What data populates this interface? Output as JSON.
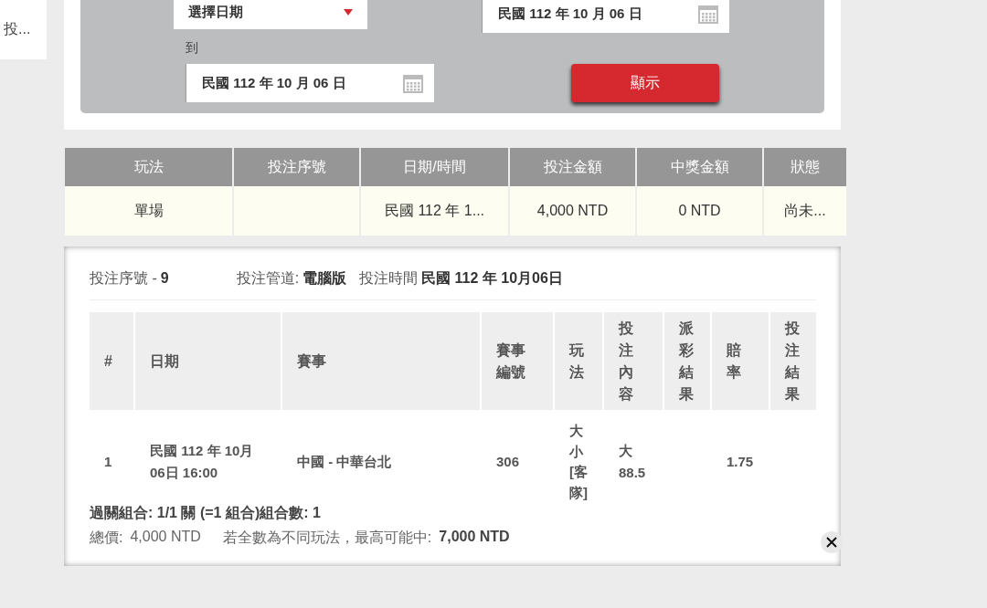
{
  "side_tab": {
    "label": "投..."
  },
  "filter": {
    "date_select": "選擇日期",
    "from_date": "民國 112 年 10 月 06 日",
    "to_label": "到",
    "to_date": "民國 112 年 10 月 06 日",
    "show_button": "顯示"
  },
  "summary_table": {
    "columns": [
      "玩法",
      "投注序號",
      "日期/時間",
      "投注金額",
      "中獎金額",
      "狀態"
    ],
    "rows": [
      [
        "單場",
        "",
        "民國 112 年 1...",
        "4,000 NTD",
        "0 NTD",
        "尚未..."
      ]
    ]
  },
  "detail": {
    "meta": [
      {
        "label": "投注序號 -",
        "value": "9"
      },
      {
        "label": "投注管道:",
        "value": "電腦版"
      },
      {
        "label": "投注時間",
        "value": "民國 112 年 10月06日"
      }
    ],
    "columns": [
      "#",
      "日期",
      "賽事",
      "賽事編號",
      "玩法",
      "投注內容",
      "派彩結果",
      "賠率",
      "投注結果"
    ],
    "rows": [
      [
        "1",
        "民國 112 年 10月 06日 16:00",
        "中國 - 中華台北",
        "306",
        "大小[客隊]",
        "大 88.5",
        "",
        "1.75",
        ""
      ]
    ],
    "combo": "過關組合: 1/1 關 (=1 組合)組合數: 1",
    "total_label": "總價:",
    "total_value": "4,000 NTD",
    "max_label": "若全數為不同玩法，最高可能中:",
    "max_value": "7,000 NTD"
  }
}
